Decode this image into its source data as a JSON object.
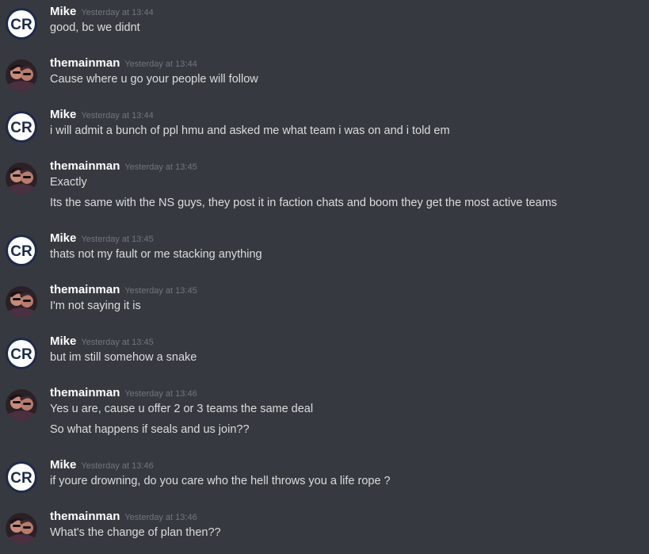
{
  "messages": [
    {
      "author": "Mike",
      "avatar": "cr-logo-avatar",
      "timestamp": "Yesterday at 13:44",
      "lines": [
        "good, bc we didnt"
      ]
    },
    {
      "author": "themainman",
      "avatar": "user-photo-avatar",
      "timestamp": "Yesterday at 13:44",
      "lines": [
        "Cause where u go your people will follow"
      ]
    },
    {
      "author": "Mike",
      "avatar": "cr-logo-avatar",
      "timestamp": "Yesterday at 13:44",
      "lines": [
        "i will admit a bunch of ppl hmu and asked me what team i was on and i told em"
      ]
    },
    {
      "author": "themainman",
      "avatar": "user-photo-avatar",
      "timestamp": "Yesterday at 13:45",
      "lines": [
        "Exactly",
        "Its the same with the NS guys, they post it in faction chats and boom they get the most active teams"
      ]
    },
    {
      "author": "Mike",
      "avatar": "cr-logo-avatar",
      "timestamp": "Yesterday at 13:45",
      "lines": [
        "thats not my fault or me stacking anything"
      ]
    },
    {
      "author": "themainman",
      "avatar": "user-photo-avatar",
      "timestamp": "Yesterday at 13:45",
      "lines": [
        "I'm not saying it is"
      ]
    },
    {
      "author": "Mike",
      "avatar": "cr-logo-avatar",
      "timestamp": "Yesterday at 13:45",
      "lines": [
        "but im still somehow a snake"
      ]
    },
    {
      "author": "themainman",
      "avatar": "user-photo-avatar",
      "timestamp": "Yesterday at 13:46",
      "lines": [
        "Yes u are, cause u offer 2 or 3 teams the same deal",
        "So what happens if seals and us join??"
      ]
    },
    {
      "author": "Mike",
      "avatar": "cr-logo-avatar",
      "timestamp": "Yesterday at 13:46",
      "lines": [
        "if youre drowning, do you care who the hell throws you a life rope ?"
      ]
    },
    {
      "author": "themainman",
      "avatar": "user-photo-avatar",
      "timestamp": "Yesterday at 13:46",
      "lines": [
        "What's the change of plan then??"
      ]
    }
  ],
  "colors": {
    "background": "#36393f",
    "username": "#ffffff",
    "timestamp": "#72767d",
    "message_text": "#dcddde"
  }
}
